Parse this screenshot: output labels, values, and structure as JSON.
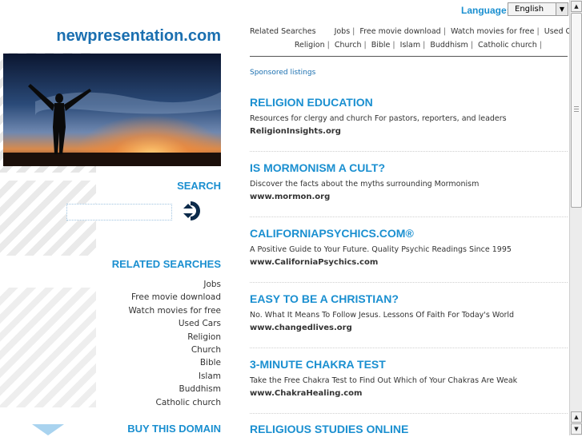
{
  "site": {
    "title": "newpresentation.com"
  },
  "language": {
    "label": "Language:",
    "selected": "English"
  },
  "search": {
    "heading": "SEARCH",
    "placeholder": ""
  },
  "related": {
    "heading": "RELATED SEARCHES",
    "items": [
      "Jobs",
      "Free movie download",
      "Watch movies for free",
      "Used Cars",
      "Religion",
      "Church",
      "Bible",
      "Islam",
      "Buddhism",
      "Catholic church"
    ]
  },
  "buy": {
    "heading": "BUY THIS DOMAIN"
  },
  "top_links": {
    "label": "Related Searches",
    "row1": [
      "Jobs",
      "Free movie download",
      "Watch movies for free",
      "Used Cars"
    ],
    "row2": [
      "Religion",
      "Church",
      "Bible",
      "Islam",
      "Buddhism",
      "Catholic church"
    ]
  },
  "sponsored_label": "Sponsored listings",
  "ads": [
    {
      "title": "RELIGION EDUCATION",
      "desc": "Resources for clergy and church For pastors, reporters, and leaders",
      "url": "ReligionInsights.org"
    },
    {
      "title": "IS MORMONISM A CULT?",
      "desc": "Discover the facts about the myths surrounding Mormonism",
      "url": "www.mormon.org"
    },
    {
      "title": "CALIFORNIAPSYCHICS.COM®",
      "desc": "A Positive Guide to Your Future. Quality Psychic Readings Since 1995",
      "url": "www.CaliforniaPsychics.com"
    },
    {
      "title": "EASY TO BE A CHRISTIAN?",
      "desc": "No. What It Means To Follow Jesus. Lessons Of Faith For Today's World",
      "url": "www.changedlives.org"
    },
    {
      "title": "3-MINUTE CHAKRA TEST",
      "desc": "Take the Free Chakra Test to Find Out Which of Your Chakras Are Weak",
      "url": "www.ChakraHealing.com"
    },
    {
      "title": "RELIGIOUS STUDIES ONLINE",
      "desc": "",
      "url": ""
    }
  ],
  "colors": {
    "accent": "#1a8fd0",
    "title": "#1a6fb0"
  },
  "icons": {
    "search_button": "arrow-right-circle-icon",
    "dropdown": "chevron-down-icon",
    "scroll_up": "arrow-up-icon",
    "scroll_down": "arrow-down-icon"
  }
}
